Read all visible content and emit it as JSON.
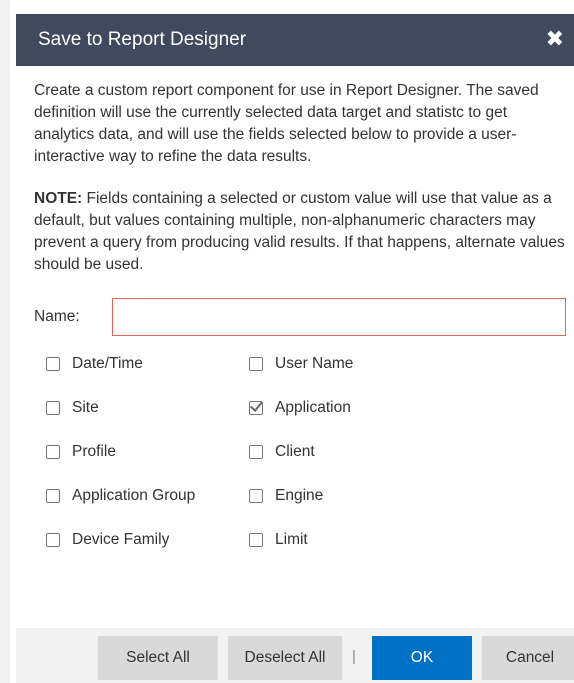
{
  "dialog": {
    "title": "Save to Report Designer",
    "close_glyph": "✖",
    "description": "Create a custom report component for use in Report Designer.  The saved definition will use the currently selected data target and statistc to get analytics data, and will use the fields selected below to provide a user-interactive way to refine the data results.",
    "note_label": "NOTE:",
    "note_text": " Fields containing a selected or custom value will use that value as a default, but values containing multiple, non-alphanumeric characters may prevent a query from producing valid results.  If that happens, alternate values should be used.",
    "name_label": "Name:",
    "name_value": "",
    "name_placeholder": ""
  },
  "fields": [
    {
      "label": "Date/Time",
      "checked": false
    },
    {
      "label": "User Name",
      "checked": false
    },
    {
      "label": "Site",
      "checked": false
    },
    {
      "label": "Application",
      "checked": true
    },
    {
      "label": "Profile",
      "checked": false
    },
    {
      "label": "Client",
      "checked": false
    },
    {
      "label": "Application Group",
      "checked": false
    },
    {
      "label": "Engine",
      "checked": false
    },
    {
      "label": "Device Family",
      "checked": false
    },
    {
      "label": "Limit",
      "checked": false
    }
  ],
  "buttons": {
    "select_all": "Select All",
    "deselect_all": "Deselect All",
    "separator": "|",
    "ok": "OK",
    "cancel": "Cancel"
  },
  "colors": {
    "titlebar": "#3f4a5c",
    "primary": "#0072c6",
    "input_border": "#d9695a"
  }
}
